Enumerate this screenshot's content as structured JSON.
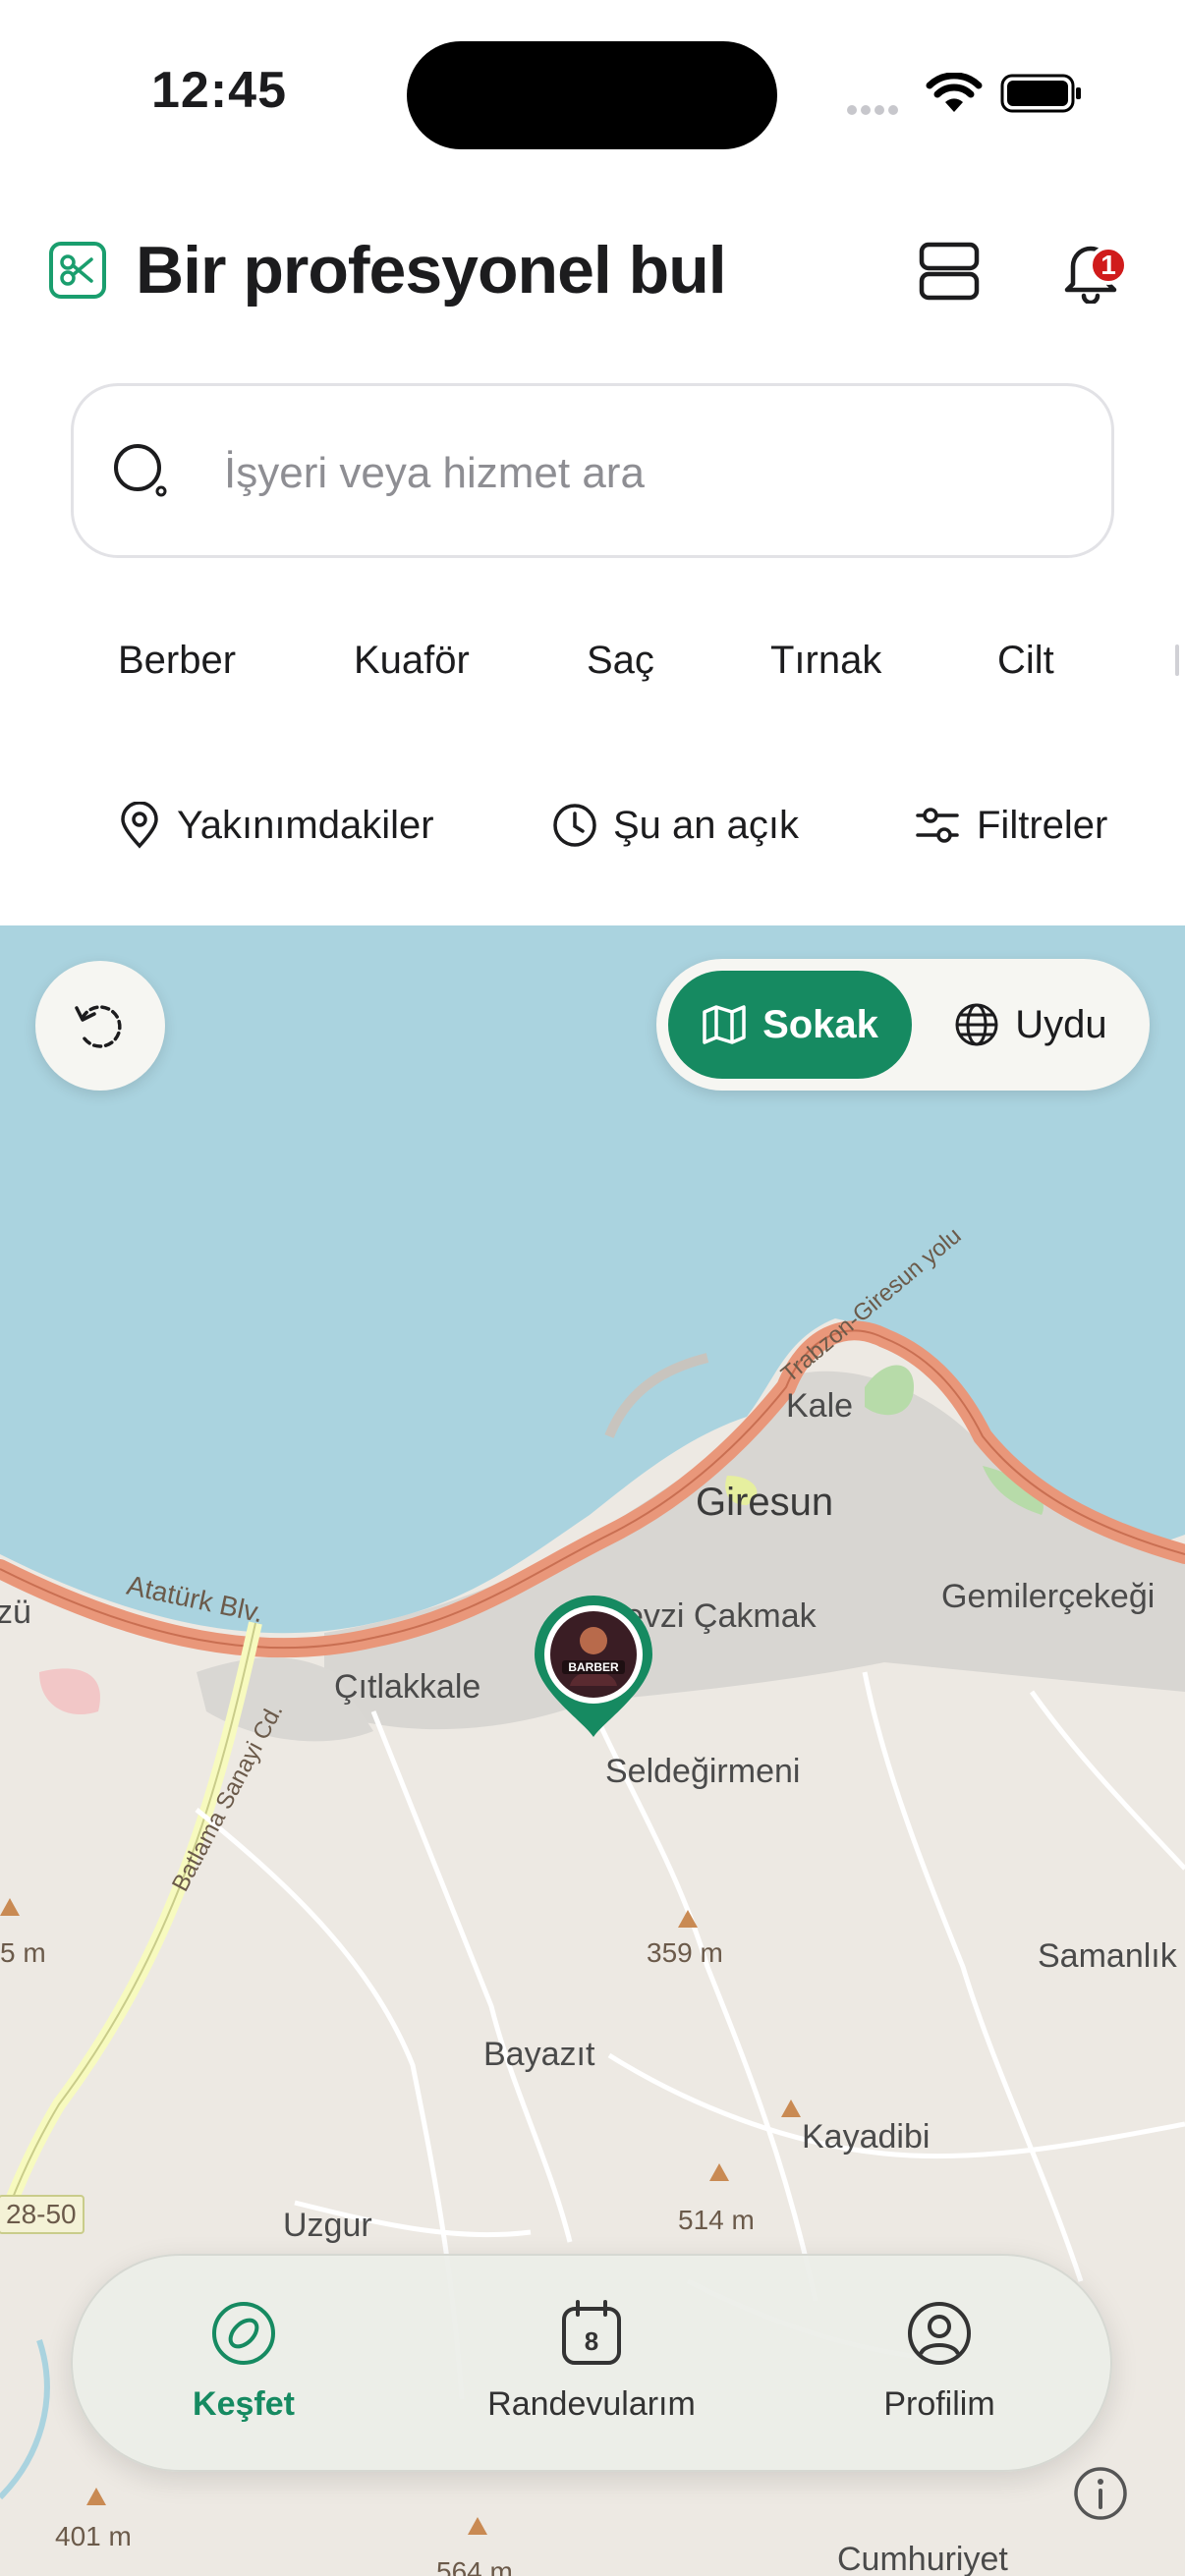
{
  "status_bar": {
    "time": "12:45"
  },
  "header": {
    "title": "Bir profesyonel bul",
    "notification_count": "1"
  },
  "search": {
    "placeholder": "İşyeri veya hizmet ara"
  },
  "categories": [
    "Berber",
    "Kuaför",
    "Saç",
    "Tırnak",
    "Cilt"
  ],
  "filters": {
    "nearby": "Yakınımdakiler",
    "open_now": "Şu an açık",
    "filters": "Filtreler"
  },
  "map": {
    "mode_street": "Sokak",
    "mode_satellite": "Uydu",
    "active_mode": "Sokak",
    "labels": {
      "kale": "Kale",
      "giresun": "Giresun",
      "gemilercekegi": "Gemilerçekeği",
      "fevzi_cakmak": "evzi Çakmak",
      "citlakkale": "Çıtlakkale",
      "ataturk_blv": "Atatürk Blv.",
      "trabzon_giresun_yolu": "Trabzon-Giresun yolu",
      "zu": "zü",
      "seldegirmeni": "Seldeğirmeni",
      "elev_359": "359 m",
      "samanlik": "Samanlık",
      "batlama_sanayi": "Batlama Sanayi Cd.",
      "elev_5": "5 m",
      "bayazit": "Bayazıt",
      "kayadibi": "Kayadibi",
      "road_28_50": "28-50",
      "uzgur": "Uzgur",
      "elev_514": "514 m",
      "elev_401": "401 m",
      "cumhuriyet": "Cumhuriyet",
      "elev_564": "564 m"
    },
    "pin": {
      "logo_text": "BARBER"
    }
  },
  "bottom_nav": {
    "items": [
      {
        "label": "Keşfet",
        "active": true
      },
      {
        "label": "Randevularım",
        "active": false
      },
      {
        "label": "Profilim",
        "active": false
      }
    ],
    "calendar_day": "8"
  },
  "colors": {
    "accent": "#168a61",
    "water": "#aad3df",
    "land": "#ede9e3",
    "highway": "#e9977a",
    "badge": "#d01b1b"
  }
}
